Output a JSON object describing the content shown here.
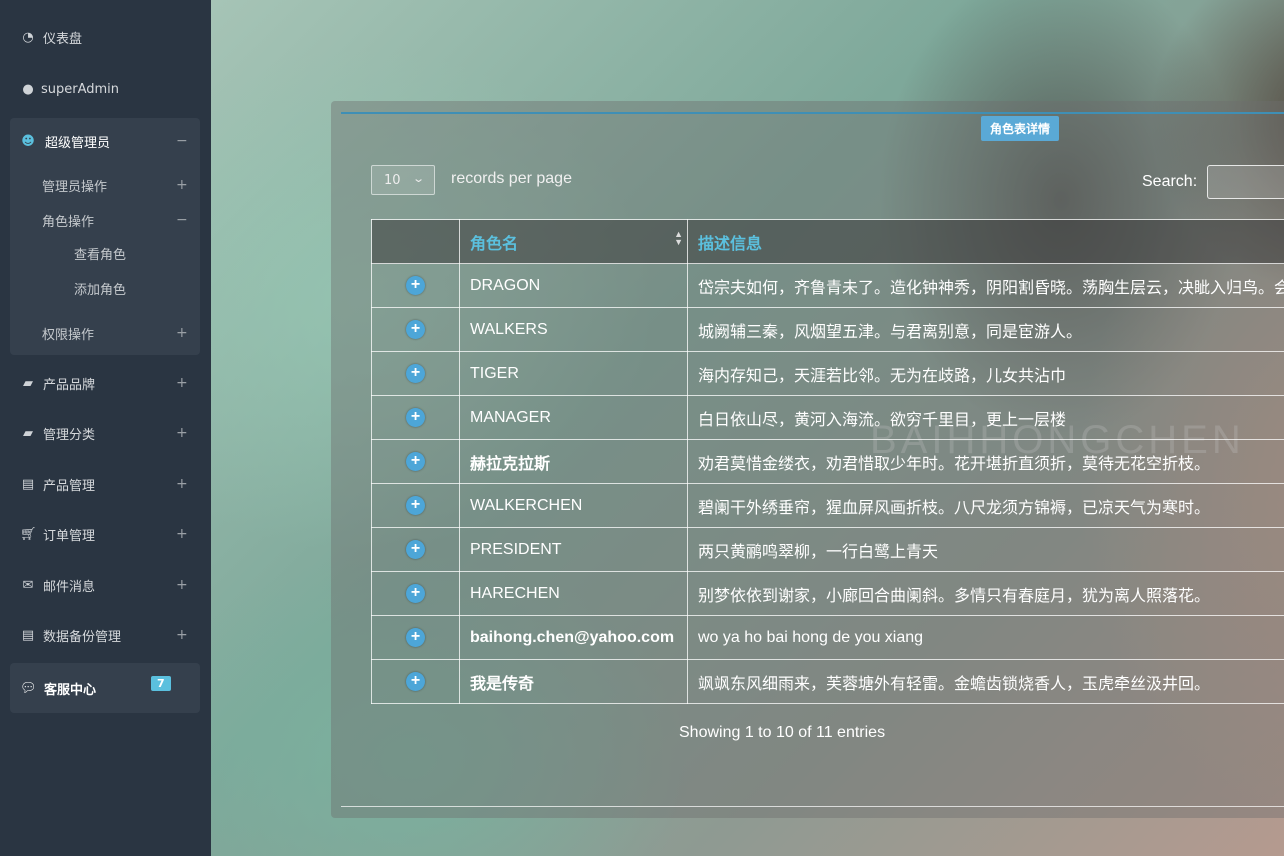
{
  "sidebar": {
    "dashboard": "仪表盘",
    "user": "superAdmin",
    "super_admin": "超级管理员",
    "super_admin_toggle": "−",
    "admin_ops": "管理员操作",
    "role_ops": "角色操作",
    "role_ops_toggle": "−",
    "view_roles": "查看角色",
    "add_role": "添加角色",
    "perm_ops": "权限操作",
    "brand": "产品品牌",
    "category": "管理分类",
    "products": "产品管理",
    "orders": "订单管理",
    "mail": "邮件消息",
    "backup": "数据备份管理",
    "service_center": "客服中心",
    "service_badge": "7",
    "expand": "+"
  },
  "panel": {
    "title": "角色表详情",
    "page_length": "10",
    "records_per_page": "records per page",
    "search_label": "Search:",
    "info": "Showing 1 to 10 of 11 entries"
  },
  "table": {
    "headers": [
      "",
      "角色名",
      "描述信息"
    ],
    "rows": [
      {
        "name": "DRAGON",
        "desc": "岱宗夫如何，齐鲁青未了。造化钟神秀，阴阳割昏晓。荡胸生层云，决眦入归鸟。会"
      },
      {
        "name": "WALKERS",
        "desc": "城阙辅三秦，风烟望五津。与君离别意，同是宦游人。"
      },
      {
        "name": "TIGER",
        "desc": "海内存知己，天涯若比邻。无为在歧路，儿女共沾巾"
      },
      {
        "name": "MANAGER",
        "desc": "白日依山尽，黄河入海流。欲穷千里目，更上一层楼"
      },
      {
        "name": "赫拉克拉斯",
        "desc": "劝君莫惜金缕衣，劝君惜取少年时。花开堪折直须折，莫待无花空折枝。"
      },
      {
        "name": "WALKERCHEN",
        "desc": "碧阑干外绣垂帘，猩血屏风画折枝。八尺龙须方锦褥，已凉天气为寒时。"
      },
      {
        "name": "PRESIDENT",
        "desc": "两只黄鹂鸣翠柳，一行白鹭上青天"
      },
      {
        "name": "HARECHEN",
        "desc": "别梦依依到谢家，小廊回合曲阑斜。多情只有春庭月，犹为离人照落花。"
      },
      {
        "name": "baihong.chen@yahoo.com",
        "desc": "wo ya ho bai hong de you xiang"
      },
      {
        "name": "我是传奇",
        "desc": "飒飒东风细雨来，芙蓉塘外有轻雷。金蟾齿锁烧香人，玉虎牵丝汲井回。"
      }
    ]
  },
  "watermark": "BAIHHONGCHEN",
  "colors": {
    "sidebar_bg": "#2a3542",
    "accent": "#5bc0de",
    "title_badge": "#5aa9d6"
  }
}
